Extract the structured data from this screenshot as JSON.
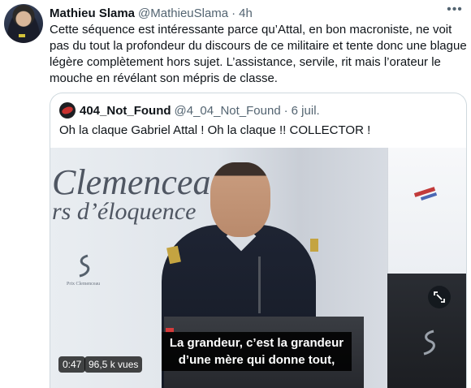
{
  "tweet": {
    "author_name": "Mathieu Slama",
    "handle": "@MathieuSlama",
    "separator": "·",
    "time": "4h",
    "more_icon": "more-horizontal-icon",
    "text": "Cette séquence est intéressante parce qu’Attal, en bon macroniste, ne voit pas du tout la profondeur du discours de ce militaire et tente donc une blague légère complètement hors sujet. L’assistance, servile, rit mais l’orateur le mouche en révélant son mépris de classe."
  },
  "quoted_tweet": {
    "author_name": "404_Not_Found",
    "handle": "@4_04_Not_Found",
    "separator": "·",
    "date": "6 juil.",
    "text": "Oh la claque Gabriel Attal ! Oh la claque !! COLLECTOR !",
    "video": {
      "backdrop_title": "Clemencea",
      "backdrop_subtitle": "rs d’éloquence",
      "logo_caption": "Prix Clemenceau",
      "subtitle_line1": "La grandeur, c’est la grandeur",
      "subtitle_line2": "d’une mère qui donne tout,",
      "duration": "0:47",
      "views": "96,5 k vues",
      "fullscreen_icon": "fullscreen-icon"
    }
  }
}
